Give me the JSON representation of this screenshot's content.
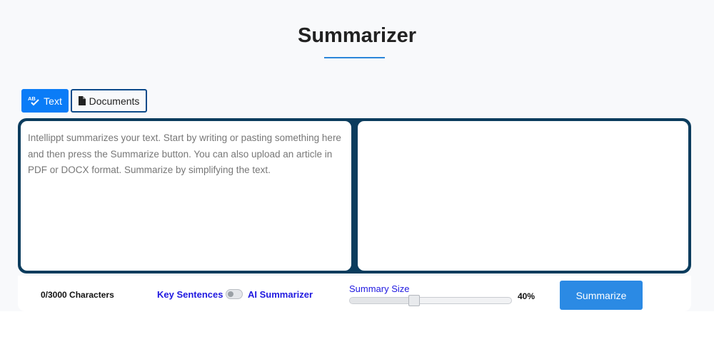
{
  "header": {
    "title": "Summarizer"
  },
  "tabs": [
    {
      "label": "Text",
      "icon": "spell-check-icon",
      "active": true
    },
    {
      "label": "Documents",
      "icon": "file-icon",
      "active": false
    }
  ],
  "editor": {
    "input_placeholder": "Intellippt summarizes your text. Start by writing or pasting something here and then press the Summarize button. You can also upload an article in PDF or DOCX format. Summarize by simplifying the text.",
    "input_value": "",
    "output_value": ""
  },
  "footer": {
    "char_count": "0/3000 Characters",
    "mode_key": "Key Sentences",
    "mode_ai": "AI Summarizer",
    "mode_toggle_on": false,
    "summary_size_label": "Summary Size",
    "summary_size_value": "40%",
    "summary_size_fraction": 0.4,
    "summarize_label": "Summarize"
  },
  "colors": {
    "accent": "#0a7cf7",
    "frame": "#0b3c5d",
    "button": "#2b8ae4",
    "mode_text": "#1f18e0"
  }
}
